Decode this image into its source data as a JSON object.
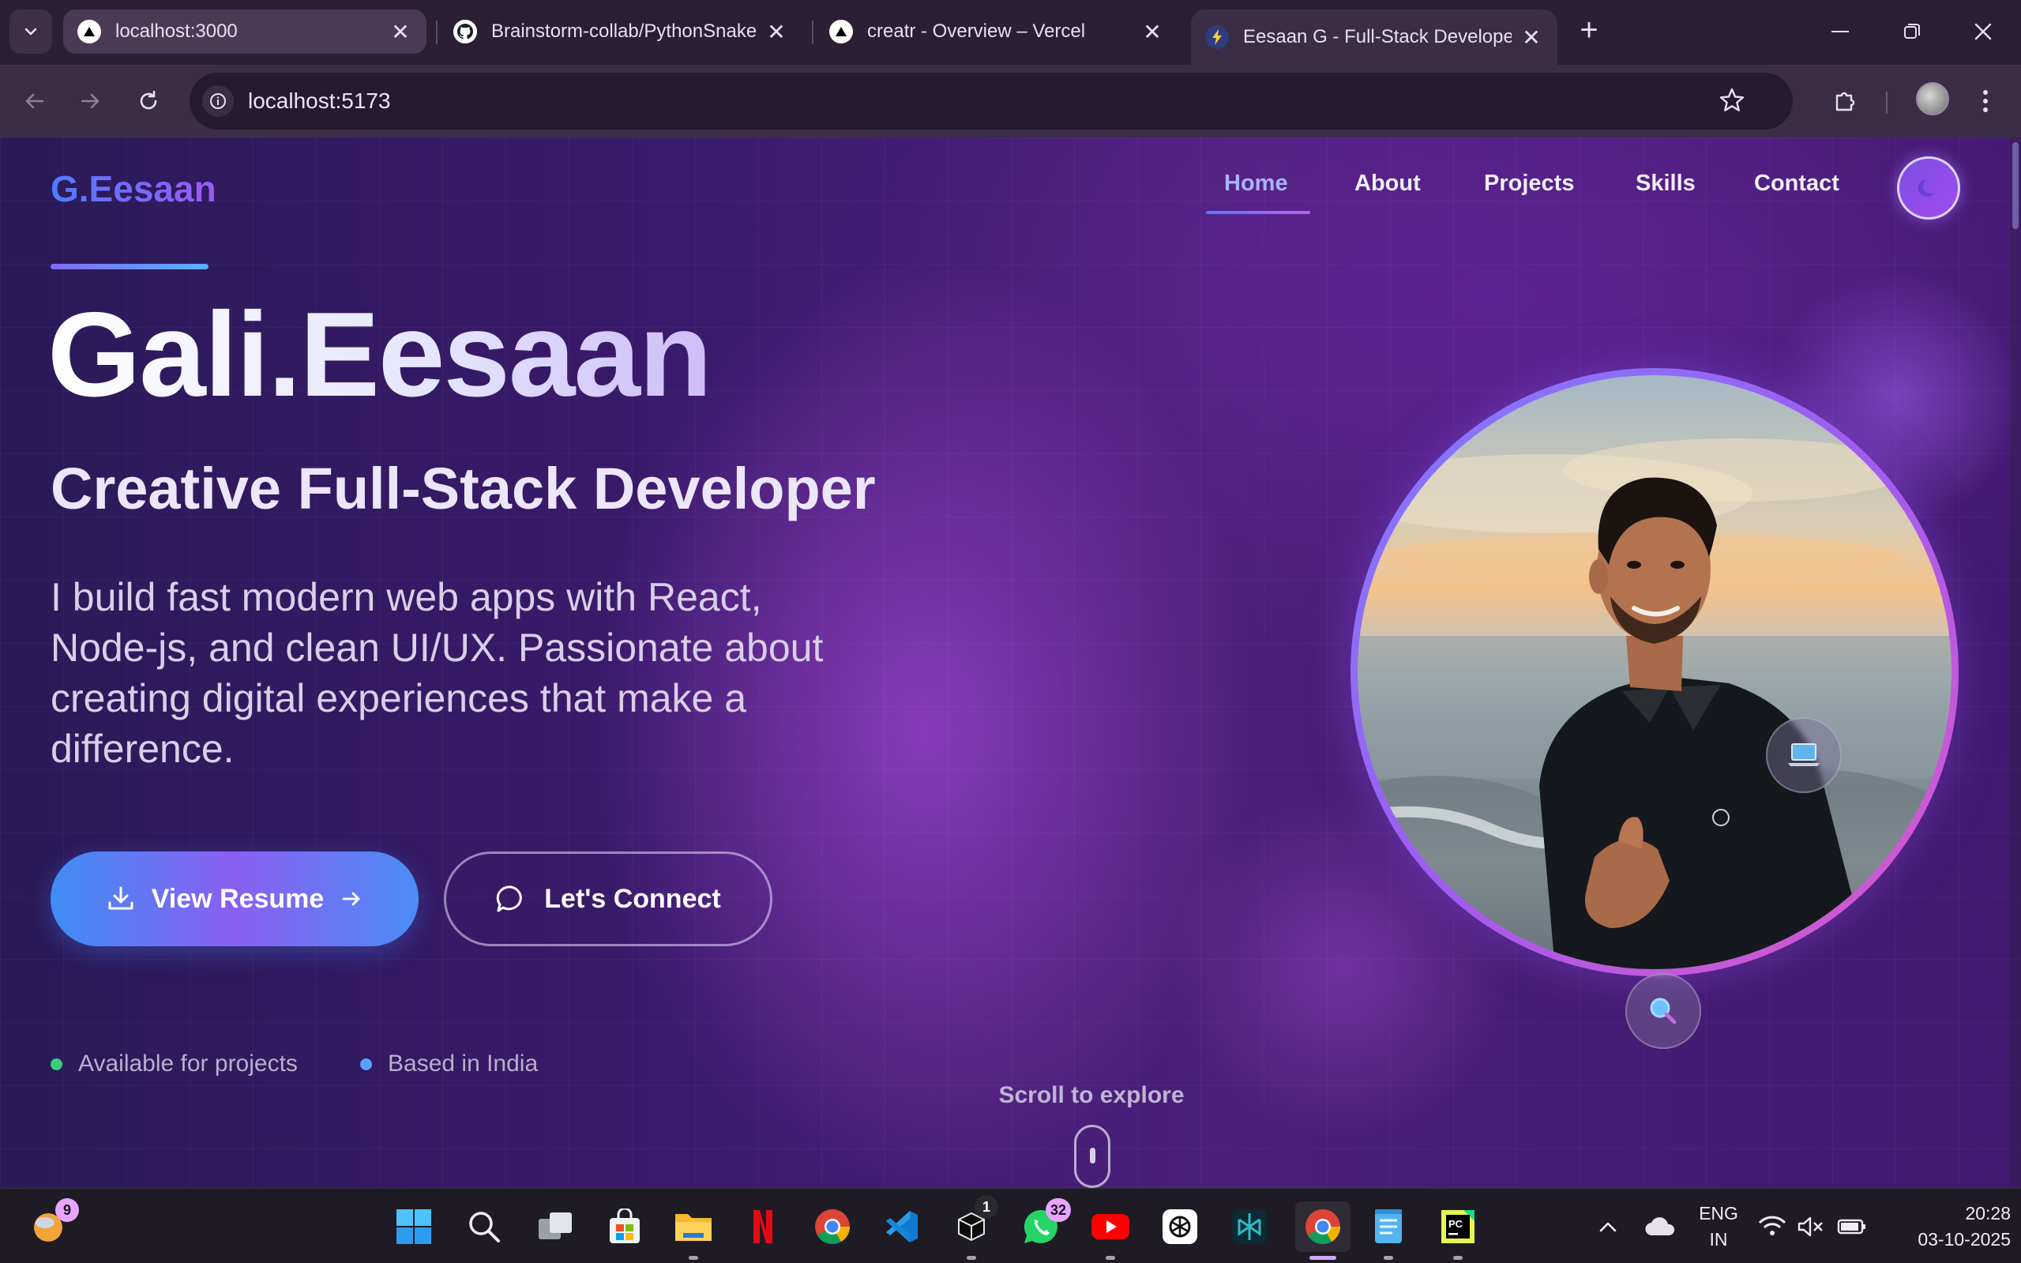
{
  "browser": {
    "tabs": [
      {
        "title": "localhost:3000",
        "icon": "vercel-triangle-icon"
      },
      {
        "title": "Brainstorm-collab/PythonSnake",
        "icon": "github-icon"
      },
      {
        "title": "creatr - Overview – Vercel",
        "icon": "vercel-triangle-icon"
      },
      {
        "title": "Eesaan G - Full-Stack Developer",
        "icon": "vite-bolt-icon"
      }
    ],
    "url": "localhost:5173"
  },
  "site": {
    "logo": "G.Eesaan",
    "nav": [
      "Home",
      "About",
      "Projects",
      "Skills",
      "Contact"
    ],
    "active_nav": "Home",
    "hero": {
      "name": "Gali.Eesaan",
      "role": "Creative Full-Stack Developer",
      "description": "I build fast modern web apps with React, Node-js, and clean UI/UX. Passionate about creating digital experiences that make a difference.",
      "primary_button": "View Resume",
      "secondary_button": "Let's Connect"
    },
    "status": [
      {
        "label": "Available for projects",
        "color": "#34d17a"
      },
      {
        "label": "Based in India",
        "color": "#5aa0ff"
      }
    ],
    "scroll_hint": "Scroll to explore",
    "floating_badges": [
      "laptop-icon",
      "magnifier-icon"
    ]
  },
  "taskbar": {
    "weather_badge": "9",
    "chatgpt_badge": "1",
    "whatsapp_badge": "32",
    "apps": [
      "start",
      "search",
      "task-view",
      "microsoft-store",
      "file-explorer",
      "netflix",
      "chrome",
      "vscode",
      "chatgpt-box",
      "whatsapp",
      "youtube",
      "openai",
      "perplexity",
      "chrome-active",
      "notepad",
      "pycharm"
    ],
    "language": "ENG",
    "region": "IN",
    "time": "20:28",
    "date": "03-10-2025"
  },
  "colors": {
    "accent_blue": "#4f7cff",
    "accent_purple": "#9b59f5",
    "accent_pink": "#e057c8",
    "available_dot": "#34d17a",
    "location_dot": "#5aa0ff"
  }
}
